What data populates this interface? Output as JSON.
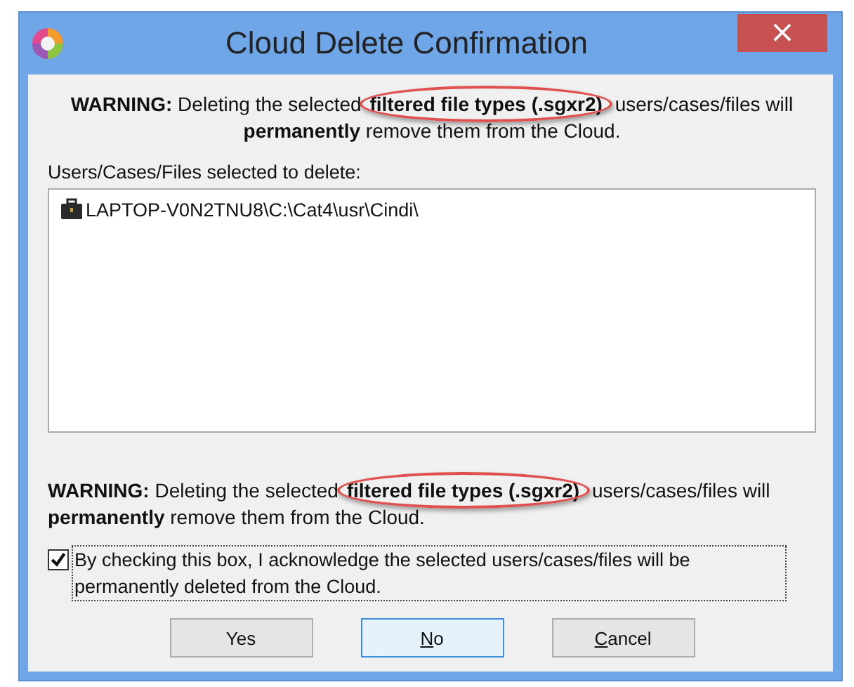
{
  "window": {
    "title": "Cloud Delete Confirmation",
    "close": "×"
  },
  "top_warning": {
    "before": "**WARNING:** Deleting the selected",
    "circled": "filtered file types (.sgxr2)",
    "after": "users/cases/files will **permanently** remove them from the Cloud."
  },
  "list": {
    "label": "Users/Cases/Files selected to delete:",
    "items": [
      {
        "text": "LAPTOP-V0N2TNU8\\C:\\Cat4\\usr\\Cindi\\"
      }
    ]
  },
  "bottom_warning": {
    "before": "**WARNING:** Deleting the selected",
    "circled": "filtered file types (.sgxr2)",
    "after": "users/cases/files will **permanently** remove them from the Cloud."
  },
  "acknowledge": {
    "label": "By checking this box, I acknowledge the selected users/cases/files will be permanently deleted from the Cloud.",
    "checked": true
  },
  "buttons": [
    {
      "label": "Yes",
      "default": false,
      "underline_first": false
    },
    {
      "label": "No",
      "default": true,
      "underline_first": true
    },
    {
      "label": "Cancel",
      "default": false,
      "underline_first": true
    }
  ]
}
